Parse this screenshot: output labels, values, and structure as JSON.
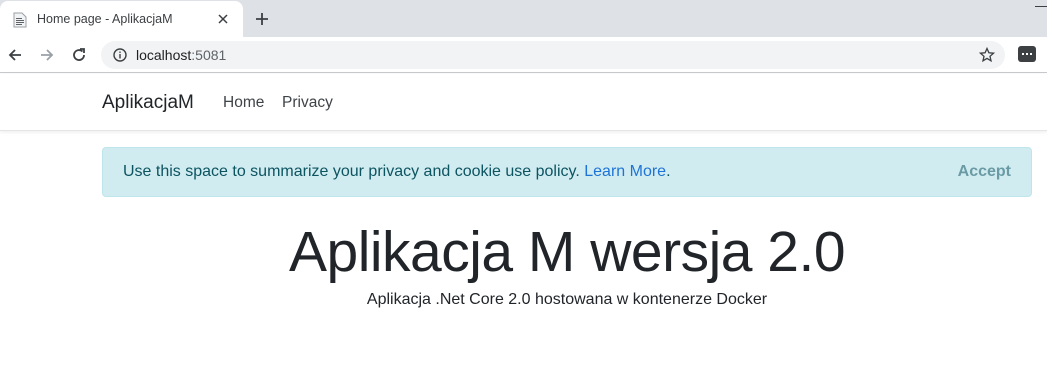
{
  "browser": {
    "tab_title": "Home page - AplikacjaM",
    "url_host": "localhost",
    "url_port": ":5081"
  },
  "navbar": {
    "brand": "AplikacjaM",
    "links": [
      "Home",
      "Privacy"
    ]
  },
  "cookie_alert": {
    "text": "Use this space to summarize your privacy and cookie use policy.",
    "link": "Learn More",
    "after_link": ".",
    "accept": "Accept"
  },
  "main": {
    "title": "Aplikacja M wersja 2.0",
    "subtitle": "Aplikacja .Net Core 2.0 hostowana w kontenerze Docker"
  },
  "icons": [
    "page-favicon-icon",
    "close-icon",
    "plus-icon",
    "back-arrow-icon",
    "forward-arrow-icon",
    "reload-icon",
    "info-icon",
    "star-icon",
    "extension-icon"
  ]
}
